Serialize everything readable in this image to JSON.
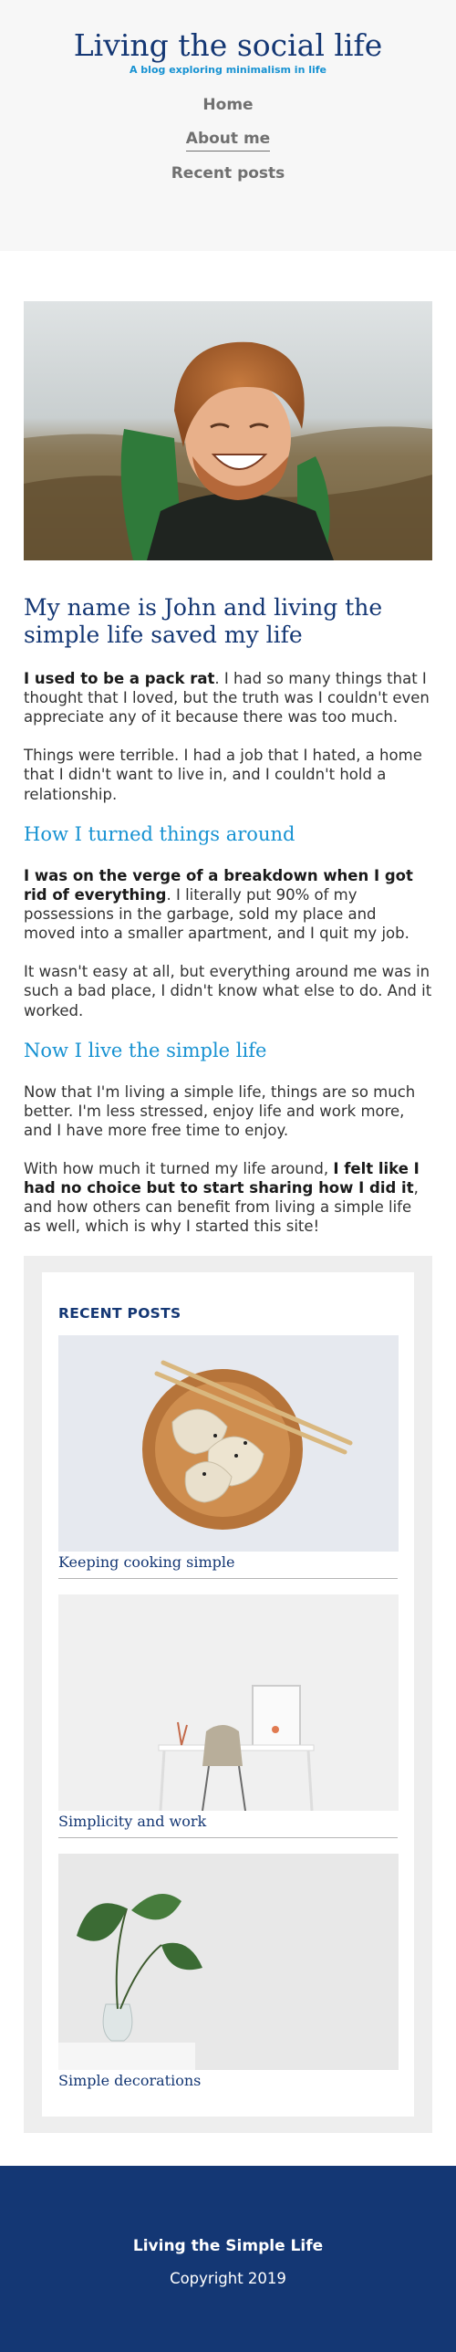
{
  "header": {
    "title": "Living the social life",
    "subtitle": "A blog exploring minimalism in life"
  },
  "nav": {
    "items": [
      {
        "label": "Home",
        "current": false
      },
      {
        "label": "About me",
        "current": true
      },
      {
        "label": "Recent posts",
        "current": false
      }
    ]
  },
  "article": {
    "hero_image_alt": "Smiling man with red hair and backpack",
    "heading": "My name is John and living the simple life saved my life",
    "p1_bold": "I used to be a pack rat",
    "p1_rest": ". I had so many things that I thought that I loved, but the truth was I couldn't even appreciate any of it because there was too much.",
    "p2": "Things were terrible. I had a job that I hated, a home that I didn't want to live in, and I couldn't hold a relationship.",
    "h2_1": "How I turned things around",
    "p3_bold": "I was on the verge of a breakdown when I got rid of everything",
    "p3_rest": ". I literally put 90% of my possessions in the garbage, sold my place and moved into a smaller apartment, and I quit my job.",
    "p4": "It wasn't easy at all, but everything around me was in such a bad place, I didn't know what else to do. And it worked.",
    "h2_2": "Now I live the simple life",
    "p5": "Now that I'm living a simple life, things are so much better. I'm less stressed, enjoy life and work more, and I have more free time to enjoy.",
    "p6_start": "With how much it turned my life around, ",
    "p6_bold": "I felt like I had no choice but to start sharing how I did it",
    "p6_end": ", and how others can benefit from living a simple life as well, which is why I started this site!"
  },
  "sidebar": {
    "widget_title": "RECENT POSTS",
    "posts": [
      {
        "title": "Keeping cooking simple",
        "image": "dumplings-on-wooden-plate"
      },
      {
        "title": "Simplicity and work",
        "image": "white-desk-and-chair"
      },
      {
        "title": "Simple decorations",
        "image": "plant-in-glass-vase"
      }
    ]
  },
  "footer": {
    "title": "Living the Simple Life",
    "copyright": "Copyright 2019"
  },
  "colors": {
    "brand_navy": "#143774",
    "accent_blue": "#1792d2",
    "nav_gray": "#707070",
    "header_bg": "#f7f7f7",
    "sidebar_bg": "#eeeeee"
  }
}
